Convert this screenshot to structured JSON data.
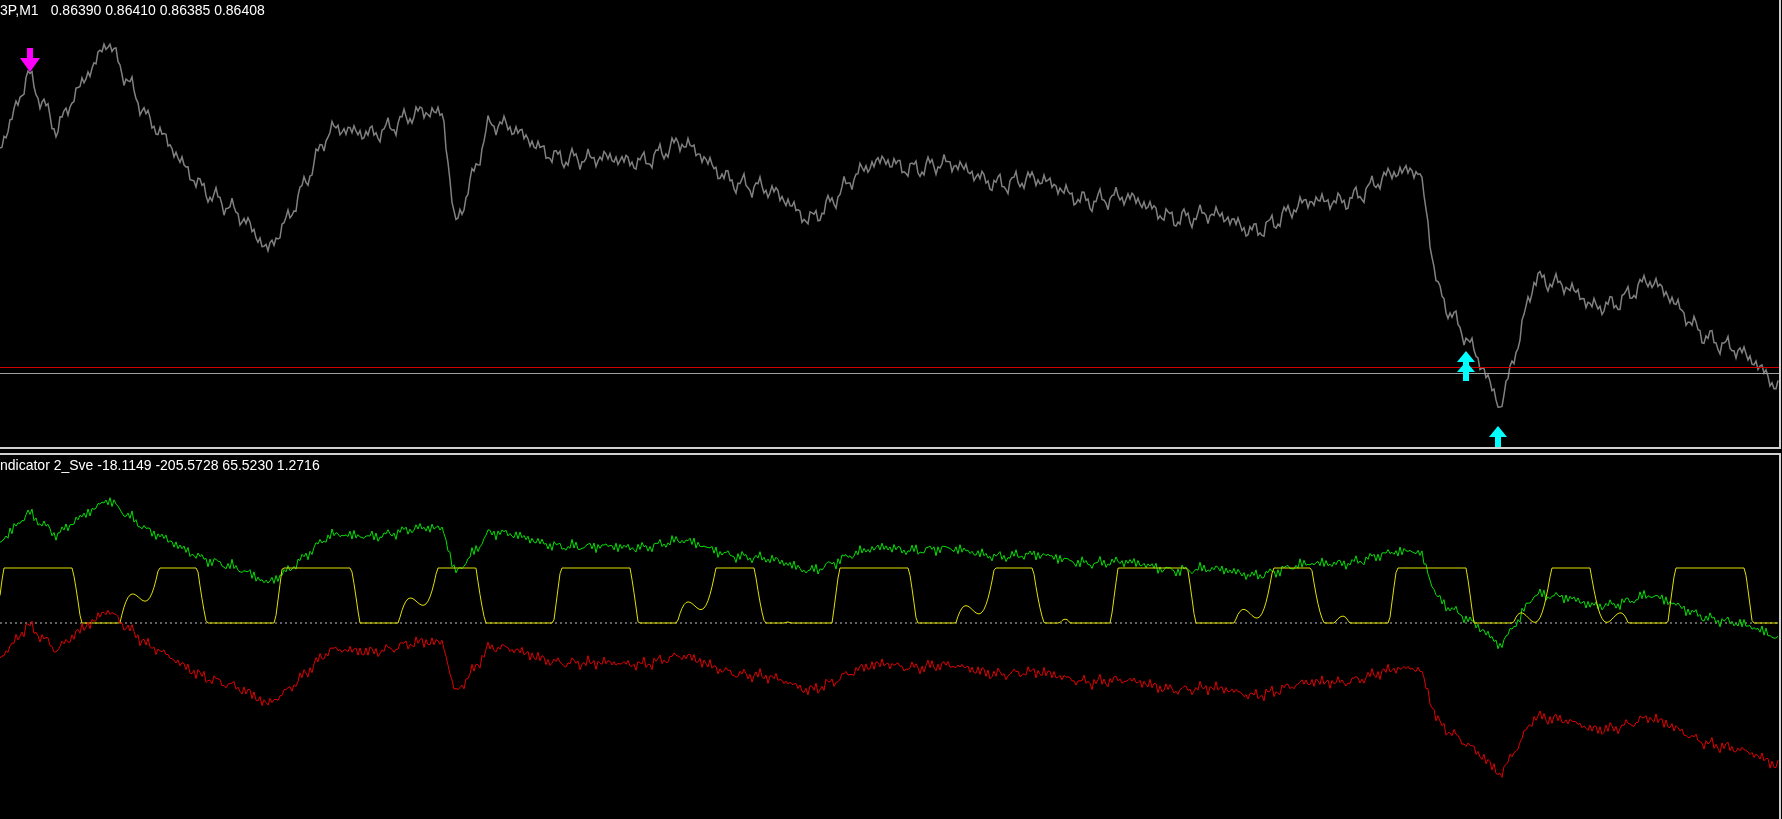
{
  "price_pane": {
    "symbol": "3P,M1",
    "values": "0.86390 0.86410 0.86385 0.86408"
  },
  "indicator_pane": {
    "header": "ndicator 2_Sve -18.1149 -205.5728 65.5230 1.2716"
  }
}
